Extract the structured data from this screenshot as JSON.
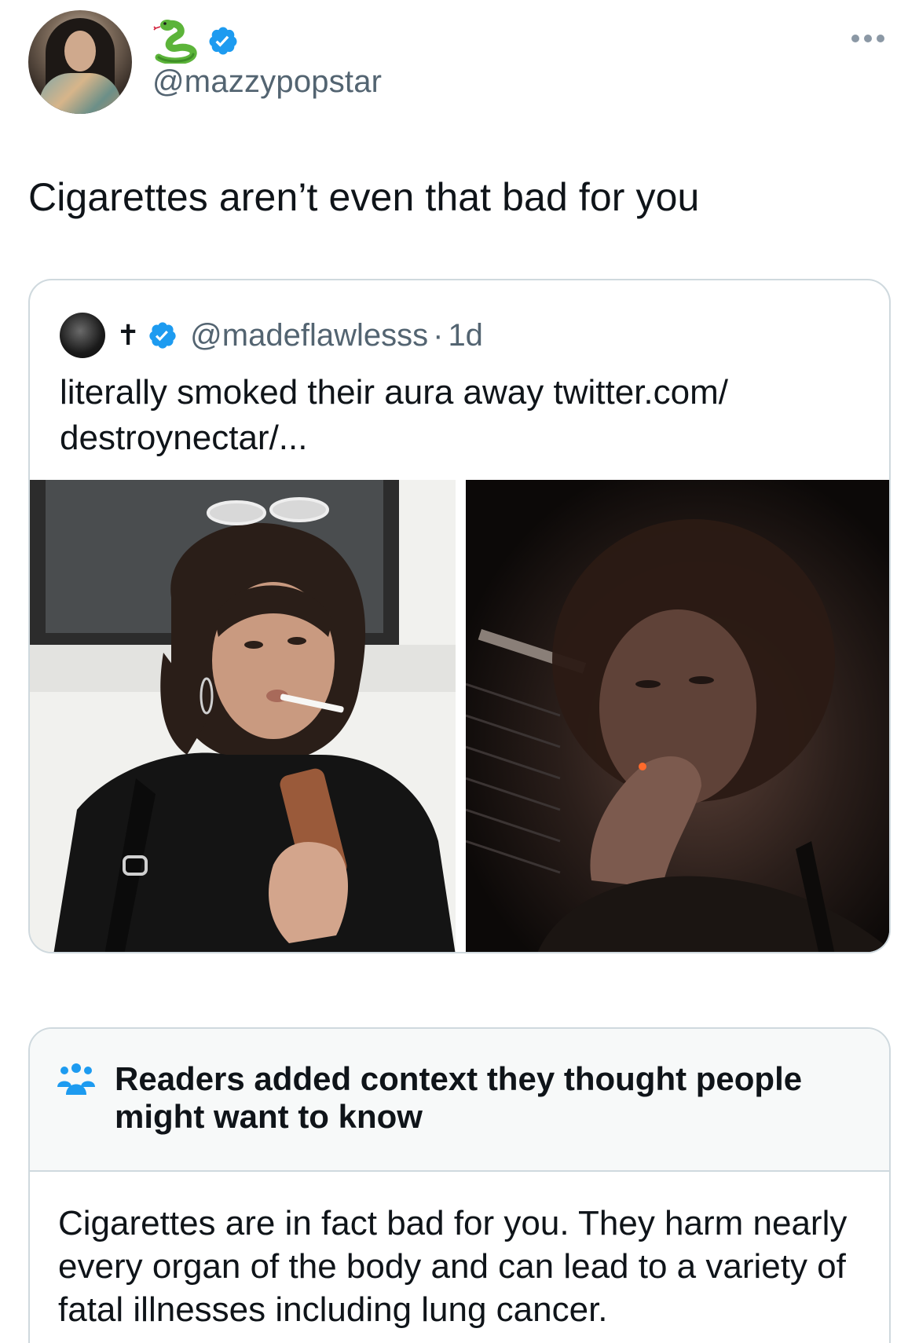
{
  "author": {
    "display_name_icons": [
      "snake-emoji",
      "verified-badge"
    ],
    "handle": "@mazzypopstar",
    "avatar": "profile-photo"
  },
  "menu": {
    "icon": "more-horizontal-icon"
  },
  "tweet": {
    "text": "Cigarettes aren’t even that bad for you"
  },
  "quoted_tweet": {
    "display_name": "✝",
    "handle": "@madeflawlesss",
    "separator": "·",
    "time": "1d",
    "text": "literally smoked their aura away twitter.com/ destroynectar/...",
    "photos": [
      "photo-left",
      "photo-right"
    ]
  },
  "community_note": {
    "icon": "people-icon",
    "title": "Readers added context they thought people might want to know",
    "body": "Cigarettes are in fact bad for you. They harm nearly every organ of the body and can lead to a variety of fatal illnesses including lung cancer."
  },
  "colors": {
    "verified": "#1d9bf0",
    "secondary_text": "#536471",
    "border": "#cfd9de",
    "note_header_bg": "#f7f9f9"
  }
}
